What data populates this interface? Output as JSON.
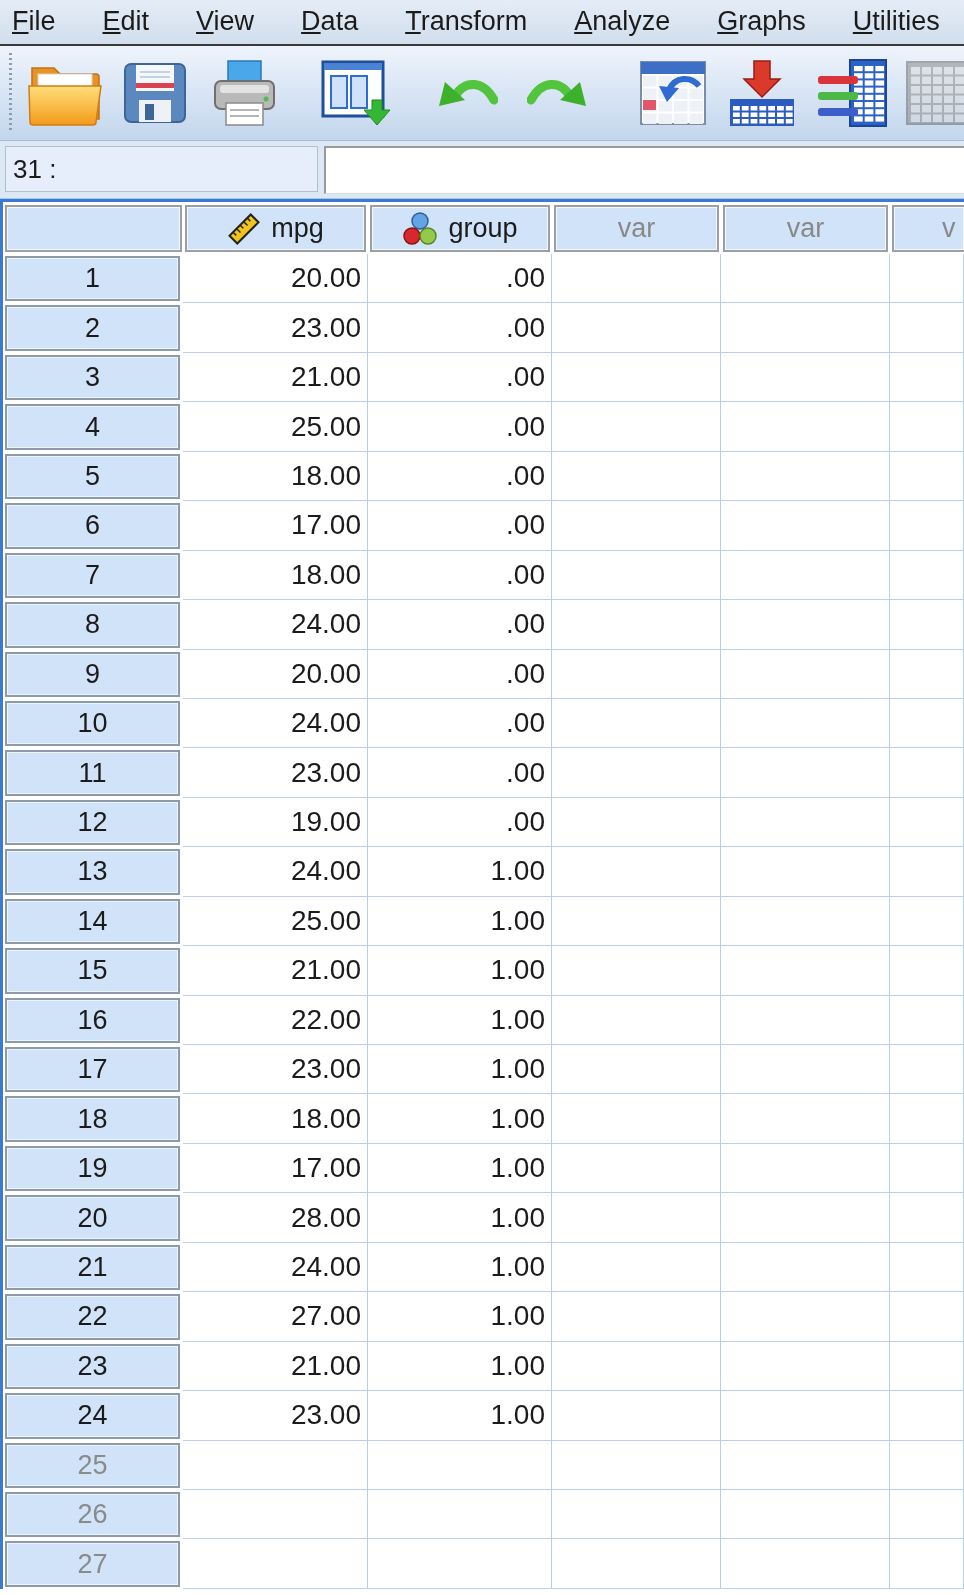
{
  "menu": [
    "File",
    "Edit",
    "View",
    "Data",
    "Transform",
    "Analyze",
    "Graphs",
    "Utilities"
  ],
  "toolbar": [
    {
      "kind": "open",
      "disabled": false
    },
    {
      "kind": "save",
      "disabled": false
    },
    {
      "kind": "print",
      "disabled": false
    },
    {
      "kind": "data-view",
      "disabled": false
    },
    {
      "kind": "undo",
      "disabled": false
    },
    {
      "kind": "redo",
      "disabled": false
    },
    {
      "kind": "goto",
      "disabled": false
    },
    {
      "kind": "insert",
      "disabled": false
    },
    {
      "kind": "variables",
      "disabled": false
    },
    {
      "kind": "table",
      "disabled": true
    }
  ],
  "cell_editor": {
    "reference": "31 :"
  },
  "columns": [
    {
      "label": "mpg",
      "kind": "scale"
    },
    {
      "label": "group",
      "kind": "nominal"
    },
    {
      "label": "var",
      "kind": "empty"
    },
    {
      "label": "var",
      "kind": "empty"
    },
    {
      "label": "v",
      "kind": "empty"
    }
  ],
  "rows": [
    {
      "number": "1",
      "values": [
        "20.00",
        ".00"
      ],
      "disabled": false
    },
    {
      "number": "2",
      "values": [
        "23.00",
        ".00"
      ],
      "disabled": false
    },
    {
      "number": "3",
      "values": [
        "21.00",
        ".00"
      ],
      "disabled": false
    },
    {
      "number": "4",
      "values": [
        "25.00",
        ".00"
      ],
      "disabled": false
    },
    {
      "number": "5",
      "values": [
        "18.00",
        ".00"
      ],
      "disabled": false
    },
    {
      "number": "6",
      "values": [
        "17.00",
        ".00"
      ],
      "disabled": false
    },
    {
      "number": "7",
      "values": [
        "18.00",
        ".00"
      ],
      "disabled": false
    },
    {
      "number": "8",
      "values": [
        "24.00",
        ".00"
      ],
      "disabled": false
    },
    {
      "number": "9",
      "values": [
        "20.00",
        ".00"
      ],
      "disabled": false
    },
    {
      "number": "10",
      "values": [
        "24.00",
        ".00"
      ],
      "disabled": false
    },
    {
      "number": "11",
      "values": [
        "23.00",
        ".00"
      ],
      "disabled": false
    },
    {
      "number": "12",
      "values": [
        "19.00",
        ".00"
      ],
      "disabled": false
    },
    {
      "number": "13",
      "values": [
        "24.00",
        "1.00"
      ],
      "disabled": false
    },
    {
      "number": "14",
      "values": [
        "25.00",
        "1.00"
      ],
      "disabled": false
    },
    {
      "number": "15",
      "values": [
        "21.00",
        "1.00"
      ],
      "disabled": false
    },
    {
      "number": "16",
      "values": [
        "22.00",
        "1.00"
      ],
      "disabled": false
    },
    {
      "number": "17",
      "values": [
        "23.00",
        "1.00"
      ],
      "disabled": false
    },
    {
      "number": "18",
      "values": [
        "18.00",
        "1.00"
      ],
      "disabled": false
    },
    {
      "number": "19",
      "values": [
        "17.00",
        "1.00"
      ],
      "disabled": false
    },
    {
      "number": "20",
      "values": [
        "28.00",
        "1.00"
      ],
      "disabled": false
    },
    {
      "number": "21",
      "values": [
        "24.00",
        "1.00"
      ],
      "disabled": false
    },
    {
      "number": "22",
      "values": [
        "27.00",
        "1.00"
      ],
      "disabled": false
    },
    {
      "number": "23",
      "values": [
        "21.00",
        "1.00"
      ],
      "disabled": false
    },
    {
      "number": "24",
      "values": [
        "23.00",
        "1.00"
      ],
      "disabled": false
    },
    {
      "number": "25",
      "disabled": true
    },
    {
      "number": "26",
      "disabled": true
    },
    {
      "number": "27",
      "disabled": true
    }
  ]
}
